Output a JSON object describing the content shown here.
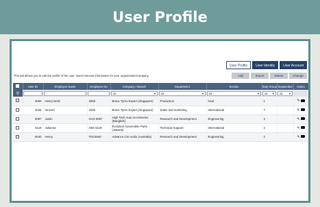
{
  "banner": {
    "title": "User Profile"
  },
  "tabs": [
    {
      "label": "User Profile",
      "active": true
    },
    {
      "label": "User Identity",
      "active": false
    },
    {
      "label": "User Account",
      "active": false
    }
  ],
  "description": "This tab allows you to edit the profile of the user; insert relevant information for your organization/company.",
  "actions": {
    "add": "Add",
    "import": "Import",
    "delete": "Delete",
    "change": "Change"
  },
  "table": {
    "columns": [
      "User ID",
      "Employee Name",
      "Employee No",
      "Company / Branch",
      "Department",
      "Section",
      "Duty Group",
      "Suspended",
      "Action"
    ],
    "filters": {
      "company": "All",
      "department": "All",
      "section": "All",
      "duty_group": "All",
      "suspended": "All"
    },
    "rows": [
      {
        "user_id": "3059",
        "name": "Henry Deltz",
        "emp_no": "3059",
        "company": "Brave Tyres Expert (Singapore)",
        "department": "Production",
        "section": "local",
        "duty_group": "1",
        "suspended": ""
      },
      {
        "user_id": "2025",
        "name": "Vincent",
        "emp_no": "2025",
        "company": "Brave Tyres Expert (Singapore)",
        "department": "Sales and marketing",
        "section": "International",
        "duty_group": "7",
        "suspended": ""
      },
      {
        "user_id": "8087",
        "name": "Justin",
        "emp_no": "GHS 8087",
        "company": "High Tech Auto Accessories (Bangkok)",
        "department": "Research and Development",
        "section": "Engineering",
        "duty_group": "3",
        "suspended": ""
      },
      {
        "user_id": "5119",
        "name": "Julianna",
        "emp_no": "ABS 5119",
        "company": "Evolution Automobile Parts (Jakarta)",
        "department": "Technical Support",
        "section": "International",
        "duty_group": "2",
        "suspended": ""
      },
      {
        "user_id": "5040",
        "name": "Henry",
        "emp_no": "TEC5040",
        "company": "Advance Car Audio (Australia)",
        "department": "Research and Development",
        "section": "Engineering",
        "duty_group": "3",
        "suspended": ""
      }
    ]
  },
  "icons": {
    "edit": "pencil-icon",
    "view": "camera-icon",
    "search": "search-icon"
  }
}
